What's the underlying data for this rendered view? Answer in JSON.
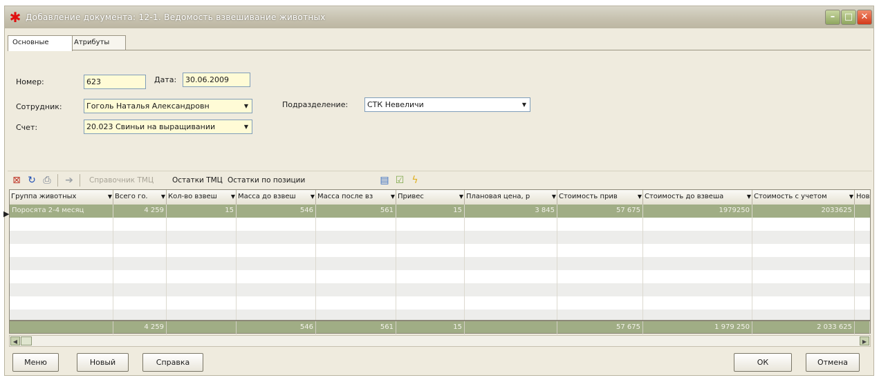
{
  "window": {
    "title": "Добавление документа: 12-1. Ведомость взвешивание животных",
    "controls": [
      "minimize",
      "maximize",
      "close"
    ]
  },
  "tabs": [
    {
      "label": "Основные",
      "active": true
    },
    {
      "label": "Атрибуты",
      "active": false
    }
  ],
  "form": {
    "number_label": "Номер:",
    "number_value": "623",
    "date_label": "Дата:",
    "date_value": "30.06.2009",
    "employee_label": "Сотрудник:",
    "employee_value": "Гоголь Наталья Александровн",
    "account_label": "Счет:",
    "account_value": "20.023 Свиньи на выращивании",
    "division_label": "Подразделение:",
    "division_value": "СТК Невеличи"
  },
  "toolbar": {
    "icons": [
      "delete-icon",
      "refresh-icon",
      "print-icon",
      "move-icon"
    ],
    "ref_label": "Справочник ТМЦ",
    "stock_label": "Остатки ТМЦ",
    "stock_pos_label": "Остатки по позиции",
    "extra_icons": [
      "document-icon",
      "checklist-icon",
      "lightning-icon"
    ]
  },
  "grid": {
    "columns": [
      "Группа животных",
      "Всего го.",
      "Кол-во взвеш",
      "Масса до взвеш",
      "Масса после вз",
      "Привес",
      "Плановая цена, р",
      "Стоимость прив",
      "Стоимость до взвеша",
      "Стоимость с учетом",
      "Нов"
    ],
    "rows": [
      [
        "Поросята 2-4 месяц",
        "4 259",
        "15",
        "546",
        "561",
        "15",
        "3 845",
        "57 675",
        "1979250",
        "2033625",
        ""
      ]
    ],
    "totals": [
      "",
      "4 259",
      "",
      "546",
      "561",
      "15",
      "",
      "57 675",
      "1 979 250",
      "2 033 625",
      ""
    ]
  },
  "buttons": {
    "menu": "Меню",
    "new": "Новый",
    "help": "Справка",
    "ok": "ОК",
    "cancel": "Отмена"
  },
  "colors": {
    "window_bg": "#efebde",
    "selection": "#a0ad85",
    "field_bg": "#fffbd6",
    "close_button": "#d43a1a"
  }
}
